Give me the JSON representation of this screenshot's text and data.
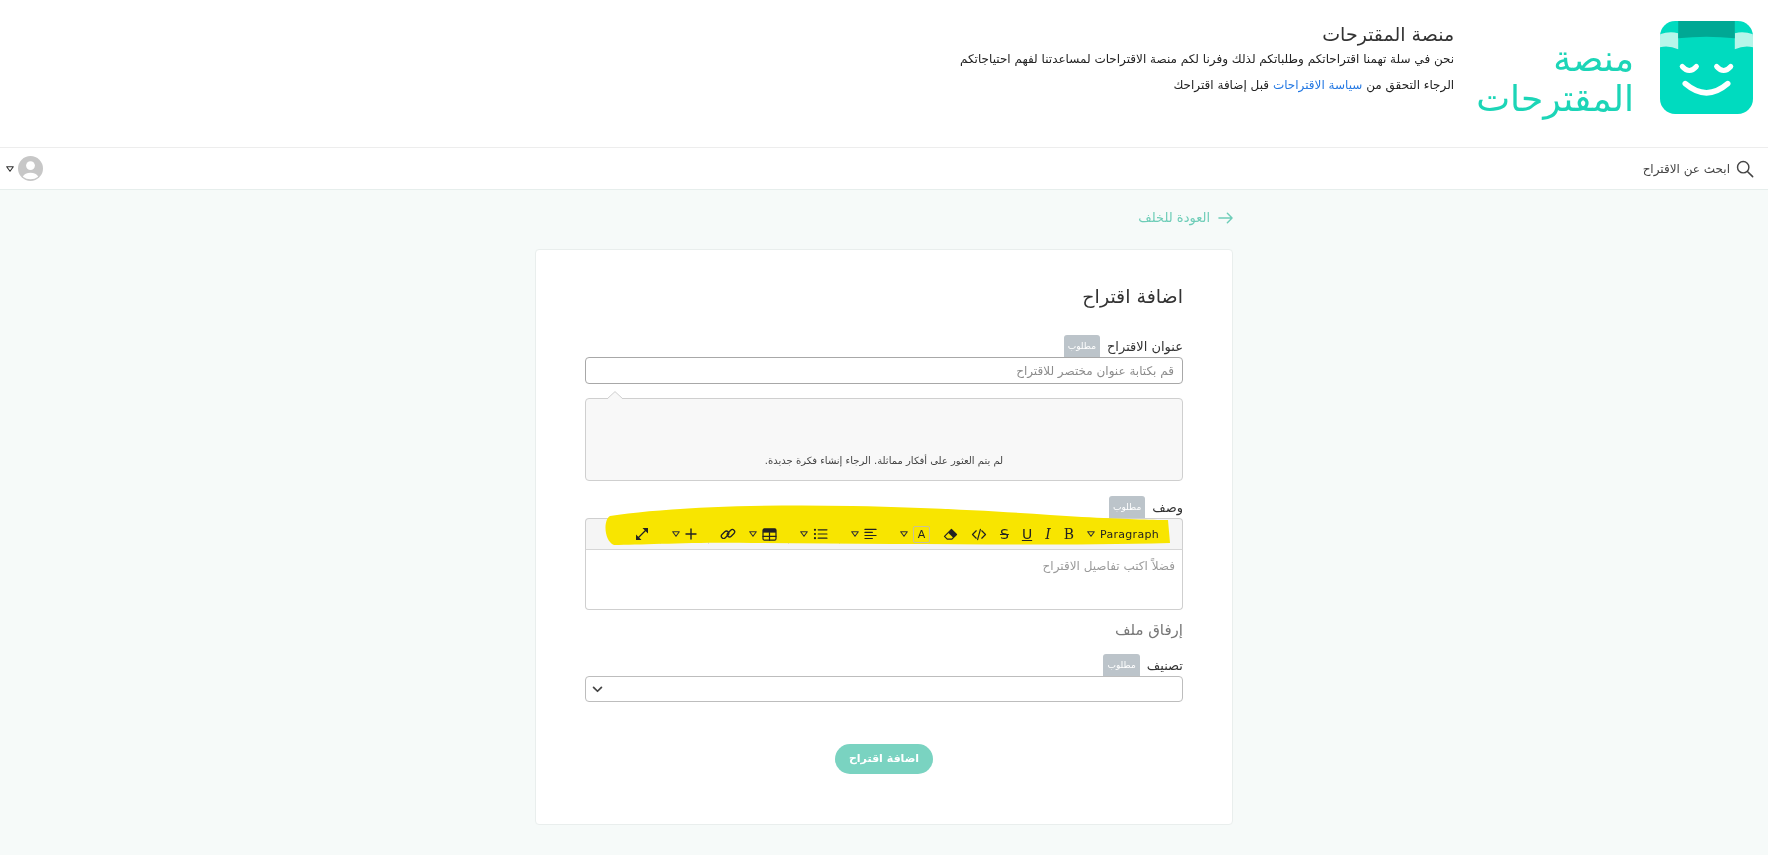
{
  "header": {
    "logo_lines": [
      "منصة",
      "المقترحات"
    ],
    "title": "منصة المقترحات",
    "intro": "نحن في سلة تهمنا اقتراحاتكم وطلباتكم لذلك وفرنا لكم منصة الاقتراحات لمساعدتنا لفهم احتياجاتكم",
    "notice": {
      "before": "الرجاء التحقق من",
      "link": "سياسة الاقتراحات",
      "after": "قبل إضافة اقتراحك"
    }
  },
  "nav": {
    "search_label": "ابحث عن الاقتراح"
  },
  "back_link": "العودة للخلف",
  "form": {
    "title": "اضافة اقتراح",
    "fields": [
      {
        "kind": "text",
        "label": "عنوان الاقتراح",
        "badge": "مطلوب",
        "placeholder": "قم بكتابة عنوان مختصر للاقتراح"
      },
      {
        "kind": "suggestions",
        "message": "لم يتم العثور على أفكار مماثلة. الرجاء إنشاء فكرة جديدة."
      },
      {
        "kind": "editor",
        "label": "وصف",
        "badge": "مطلوب",
        "placeholder": "فضلاً اكتب تفاصيل الاقتراح",
        "toolbar": [
          [
            {
              "kind": "format",
              "label": "Paragraph",
              "dropdown": true
            },
            {
              "kind": "bold",
              "label": "B",
              "dropdown": false
            },
            {
              "kind": "italic",
              "label": "I",
              "dropdown": false
            },
            {
              "kind": "underline",
              "label": "U",
              "dropdown": false
            },
            {
              "kind": "strike",
              "label": "S",
              "dropdown": false
            },
            {
              "kind": "code",
              "dropdown": false
            },
            {
              "kind": "eraser",
              "dropdown": false
            },
            {
              "kind": "color",
              "label": "A",
              "dropdown": true
            }
          ],
          [
            {
              "kind": "align",
              "dropdown": true
            }
          ],
          [
            {
              "kind": "list",
              "dropdown": true
            }
          ],
          [
            {
              "kind": "table",
              "dropdown": true
            },
            {
              "kind": "link",
              "dropdown": false
            }
          ],
          [
            {
              "kind": "insert",
              "dropdown": true
            }
          ],
          [
            {
              "kind": "fullscreen",
              "dropdown": false
            }
          ]
        ]
      },
      {
        "kind": "attachment",
        "label": "إرفاق ملف"
      },
      {
        "kind": "select",
        "label": "تصنيف",
        "badge": "مطلوب"
      }
    ],
    "submit": "اضافة اقتراح"
  }
}
